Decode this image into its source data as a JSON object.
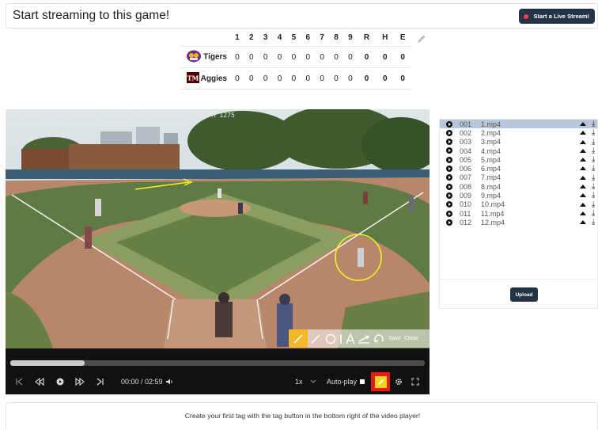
{
  "header": {
    "title": "Start streaming to this game!",
    "live_button": "Start a Live Stream!"
  },
  "scoreboard": {
    "columns": [
      "1",
      "2",
      "3",
      "4",
      "5",
      "6",
      "7",
      "8",
      "9",
      "R",
      "H",
      "E"
    ],
    "teams": [
      {
        "name": "Tigers",
        "scores": [
          "0",
          "0",
          "0",
          "0",
          "0",
          "0",
          "0",
          "0",
          "0",
          "0",
          "0",
          "0"
        ]
      },
      {
        "name": "Aggies",
        "scores": [
          "0",
          "0",
          "0",
          "0",
          "0",
          "0",
          "0",
          "0",
          "0",
          "0",
          "0",
          "0"
        ]
      }
    ]
  },
  "video": {
    "overlay": "Post Oak Little League, Pee Wee 2023-05-04 05:32:02 PM  1275",
    "draw_save": "Save",
    "draw_close": "Close",
    "time": "00:00 / 02:59",
    "speed": "1x",
    "autoplay": "Auto-play",
    "progress": 0.18
  },
  "playlist": {
    "items": [
      {
        "num": "001",
        "name": "1.mp4"
      },
      {
        "num": "002",
        "name": "2.mp4"
      },
      {
        "num": "003",
        "name": "3.mp4"
      },
      {
        "num": "004",
        "name": "4.mp4"
      },
      {
        "num": "005",
        "name": "5.mp4"
      },
      {
        "num": "006",
        "name": "6.mp4"
      },
      {
        "num": "007",
        "name": "7.mp4"
      },
      {
        "num": "008",
        "name": "8.mp4"
      },
      {
        "num": "009",
        "name": "9.mp4"
      },
      {
        "num": "010",
        "name": "10.mp4"
      },
      {
        "num": "011",
        "name": "11.mp4"
      },
      {
        "num": "012",
        "name": "12.mp4"
      }
    ],
    "upload": "Upload"
  },
  "tags": {
    "empty_text": "Create your first tag with the tag button in the bottom right of the video player!"
  },
  "colors": {
    "accent": "#253346",
    "live_dot": "#ff3b46",
    "tag_button": "#e61c1c",
    "tag_icon": "#f5d51a",
    "annotation": "#f2f22a"
  }
}
